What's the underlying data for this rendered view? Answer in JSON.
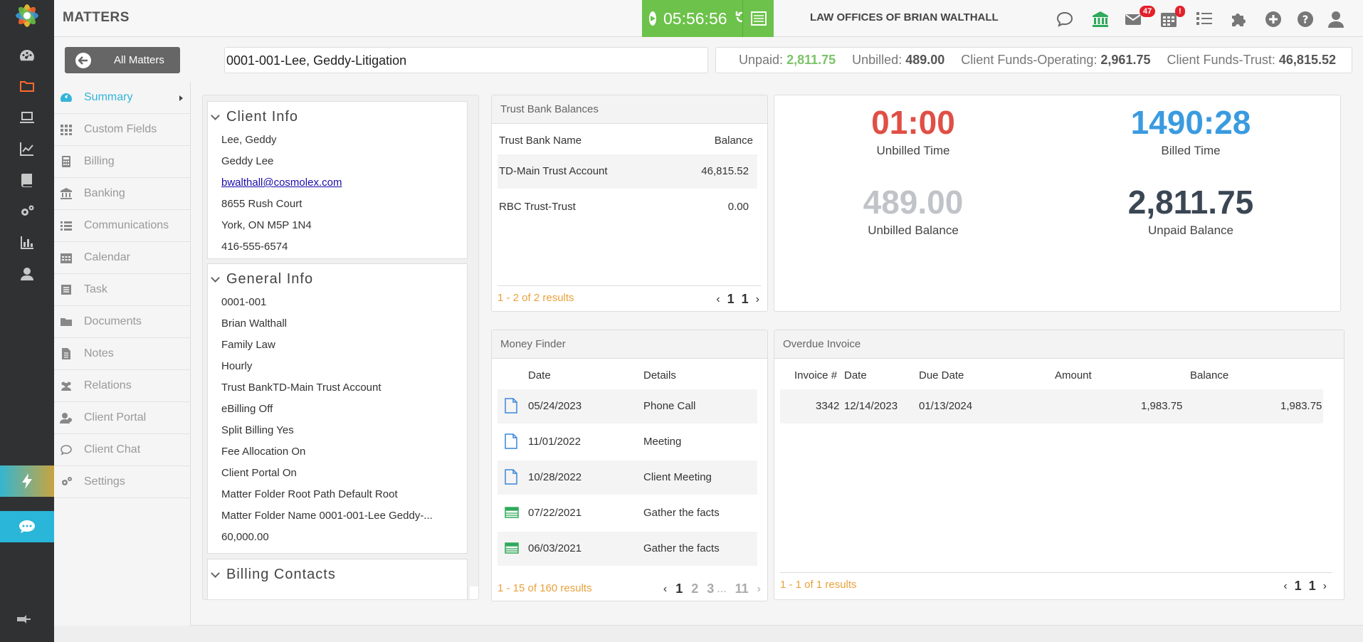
{
  "header": {
    "title": "MATTERS",
    "timer": "05:56:56",
    "firm": "LAW OFFICES OF BRIAN WALTHALL",
    "mail_badge": "47",
    "calendar_badge": "!"
  },
  "subbar": {
    "all_matters": "All Matters",
    "matter": "0001-001-Lee, Geddy-Litigation",
    "unpaid_label": "Unpaid:",
    "unpaid": "2,811.75",
    "unbilled_label": "Unbilled:",
    "unbilled": "489.00",
    "operating_label": "Client Funds-Operating:",
    "operating": "2,961.75",
    "trust_label": "Client Funds-Trust:",
    "trust": "46,815.52"
  },
  "nav": [
    {
      "label": "Summary",
      "icon": "dashboard-icon"
    },
    {
      "label": "Custom Fields",
      "icon": "grid-icon"
    },
    {
      "label": "Billing",
      "icon": "calculator-icon"
    },
    {
      "label": "Banking",
      "icon": "bank-icon"
    },
    {
      "label": "Communications",
      "icon": "list-icon"
    },
    {
      "label": "Calendar",
      "icon": "calendar-icon"
    },
    {
      "label": "Task",
      "icon": "task-icon"
    },
    {
      "label": "Documents",
      "icon": "folder-icon"
    },
    {
      "label": "Notes",
      "icon": "note-icon"
    },
    {
      "label": "Relations",
      "icon": "people-icon"
    },
    {
      "label": "Client Portal",
      "icon": "portal-icon"
    },
    {
      "label": "Client Chat",
      "icon": "chat-icon"
    },
    {
      "label": "Settings",
      "icon": "gears-icon"
    }
  ],
  "client_info": {
    "title": "Client Info",
    "rows": [
      "Lee, Geddy",
      "Geddy Lee",
      "bwalthall@cosmolex.com",
      "8655 Rush Court",
      "York, ON M5P 1N4",
      "416-555-6574"
    ]
  },
  "general_info": {
    "title": "General Info",
    "rows": [
      "0001-001",
      "Brian Walthall",
      "Family Law",
      "Hourly",
      "Trust BankTD-Main Trust Account",
      "eBilling Off",
      "Split Billing Yes",
      "Fee Allocation On",
      "Client Portal On",
      "Matter Folder Root Path Default Root",
      "Matter Folder Name 0001-001-Lee Geddy-...",
      "60,000.00"
    ]
  },
  "billing_contacts": {
    "title": "Billing Contacts"
  },
  "trust_balances": {
    "title": "Trust Bank Balances",
    "col_name": "Trust Bank Name",
    "col_balance": "Balance",
    "rows": [
      {
        "name": "TD-Main Trust Account",
        "balance": "46,815.52"
      },
      {
        "name": "RBC Trust-Trust",
        "balance": "0.00"
      }
    ],
    "results": "1 - 2 of 2 results",
    "page_a": "1",
    "page_b": "1"
  },
  "stats": {
    "unbilled_time": "01:00",
    "unbilled_time_label": "Unbilled Time",
    "billed_time": "1490:28",
    "billed_time_label": "Billed Time",
    "unbilled_balance": "489.00",
    "unbilled_balance_label": "Unbilled Balance",
    "unpaid_balance": "2,811.75",
    "unpaid_balance_label": "Unpaid Balance"
  },
  "money_finder": {
    "title": "Money Finder",
    "col_date": "Date",
    "col_details": "Details",
    "rows": [
      {
        "date": "05/24/2023",
        "details": "Phone Call",
        "icon": "document-icon"
      },
      {
        "date": "11/01/2022",
        "details": "Meeting",
        "icon": "document-icon"
      },
      {
        "date": "10/28/2022",
        "details": "Client Meeting",
        "icon": "document-icon"
      },
      {
        "date": "07/22/2021",
        "details": "Gather the facts",
        "icon": "spreadsheet-icon"
      },
      {
        "date": "06/03/2021",
        "details": "Gather the facts",
        "icon": "spreadsheet-icon"
      }
    ],
    "results": "1 - 15 of 160 results",
    "pages": [
      "1",
      "2",
      "3",
      "...",
      "11"
    ]
  },
  "overdue": {
    "title": "Overdue Invoice",
    "cols": [
      "Invoice #",
      "Date",
      "Due Date",
      "Amount",
      "Balance"
    ],
    "rows": [
      {
        "invoice": "3342",
        "date": "12/14/2023",
        "due": "01/13/2024",
        "amount": "1,983.75",
        "balance": "1,983.75"
      }
    ],
    "results": "1 - 1 of 1 results",
    "page_a": "1",
    "page_b": "1"
  },
  "colors": {
    "accent": "#33b4d9",
    "timer_green": "#6cc24a",
    "unbilled_time_red": "#e04f45",
    "billed_time_blue": "#3a9be0",
    "unbilled_balance_gray": "#c0c4c8",
    "unpaid_balance_navy": "#3b4654",
    "results_orange": "#e8a13c"
  }
}
